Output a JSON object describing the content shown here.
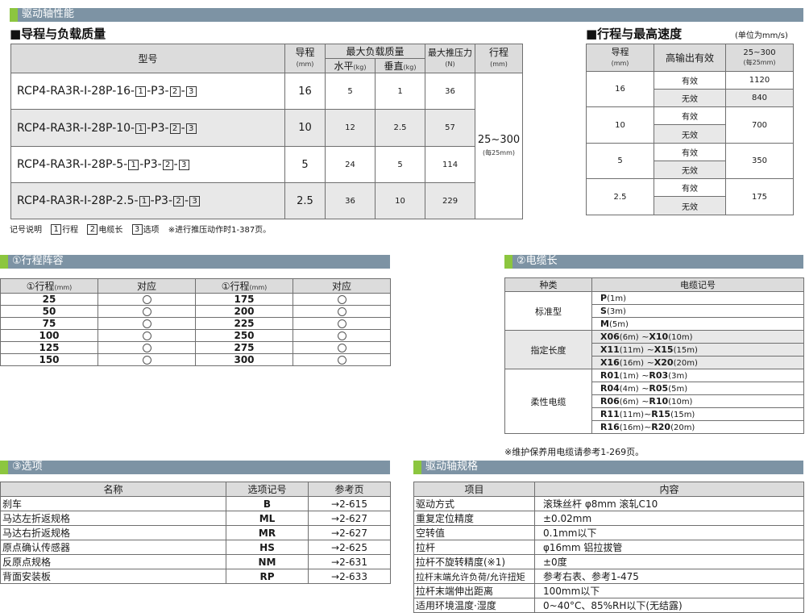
{
  "top_bar": {
    "title": "驱动轴性能"
  },
  "lead_section": {
    "title": "■导程与负载质量",
    "headers": {
      "model": "型号",
      "lead": "导程",
      "lead_unit": "(mm)",
      "max_load": "最大负载质量",
      "horizontal": "水平",
      "horizontal_unit": "(kg)",
      "vertical": "垂直",
      "vertical_unit": "(kg)",
      "max_push": "最大推压力",
      "max_push_unit": "(N)",
      "stroke": "行程",
      "stroke_unit": "(mm)"
    },
    "rows": [
      {
        "model_prefix": "RCP4-RA3R-I-28P-16-",
        "lead": "16",
        "horizontal": "5",
        "vertical": "1",
        "push": "36"
      },
      {
        "model_prefix": "RCP4-RA3R-I-28P-10-",
        "lead": "10",
        "horizontal": "12",
        "vertical": "2.5",
        "push": "57"
      },
      {
        "model_prefix": "RCP4-RA3R-I-28P-5-",
        "lead": "5",
        "horizontal": "24",
        "vertical": "5",
        "push": "114"
      },
      {
        "model_prefix": "RCP4-RA3R-I-28P-2.5-",
        "lead": "2.5",
        "horizontal": "36",
        "vertical": "10",
        "push": "229"
      }
    ],
    "model_parts": {
      "n1": "1",
      "p3": "-P3-",
      "n2": "2",
      "dash": "-",
      "n3": "3"
    },
    "stroke_value": "25~300",
    "stroke_note": "(每25mm)",
    "legend": {
      "prefix": "记号说明",
      "n1": "1",
      "l1": "行程",
      "n2": "2",
      "l2": "电缆长",
      "n3": "3",
      "l3": "选项",
      "note": "※进行推压动作时1-387页。"
    }
  },
  "speed_section": {
    "title": "■行程与最高速度",
    "unit": "(单位为mm/s)",
    "headers": {
      "lead": "导程",
      "lead_unit": "(mm)",
      "hi_out": "高输出有效",
      "stroke": "25~300",
      "stroke_note": "(每25mm)"
    },
    "rows": [
      {
        "lead": "16",
        "on": "有效",
        "off": "无效",
        "on_val": "1120",
        "off_val": "840"
      },
      {
        "lead": "10",
        "on": "有效",
        "off": "无效",
        "val": "700"
      },
      {
        "lead": "5",
        "on": "有效",
        "off": "无效",
        "val": "350"
      },
      {
        "lead": "2.5",
        "on": "有效",
        "off": "无效",
        "val": "175"
      }
    ]
  },
  "stroke_lineup": {
    "title": "①行程阵容",
    "headers": {
      "stroke": "①行程",
      "unit": "(mm)",
      "support": "对应"
    },
    "left": [
      "25",
      "50",
      "75",
      "100",
      "125",
      "150"
    ],
    "right": [
      "175",
      "200",
      "225",
      "250",
      "275",
      "300"
    ]
  },
  "cable": {
    "title": "②电缆长",
    "headers": {
      "type": "种类",
      "code": "电缆记号"
    },
    "groups": [
      {
        "type": "标准型",
        "rows": [
          {
            "a": "P",
            "al": "(1m)",
            "b": "",
            "bl": ""
          },
          {
            "a": "S",
            "al": "(3m)",
            "b": "",
            "bl": ""
          },
          {
            "a": "M",
            "al": "(5m)",
            "b": "",
            "bl": ""
          }
        ]
      },
      {
        "type": "指定长度",
        "rows": [
          {
            "a": "X06",
            "al": "(6m)",
            "b": "X10",
            "bl": "(10m)"
          },
          {
            "a": "X11",
            "al": "(11m)",
            "b": "X15",
            "bl": "(15m)"
          },
          {
            "a": "X16",
            "al": "(16m)",
            "b": "X20",
            "bl": "(20m)"
          }
        ]
      },
      {
        "type": "柔性电缆",
        "rows": [
          {
            "a": "R01",
            "al": "(1m)",
            "b": "R03",
            "bl": "(3m)"
          },
          {
            "a": "R04",
            "al": "(4m)",
            "b": "R05",
            "bl": "(5m)"
          },
          {
            "a": "R06",
            "al": "(6m)",
            "b": "R10",
            "bl": "(10m)"
          },
          {
            "a": "R11",
            "al": "(11m)",
            "b": "R15",
            "bl": "(15m)"
          },
          {
            "a": "R16",
            "al": "(16m)",
            "b": "R20",
            "bl": "(20m)"
          }
        ]
      }
    ],
    "tilde": "~",
    "note": "※维护保养用电缆请参考1-269页。"
  },
  "options": {
    "title": "③选项",
    "headers": {
      "name": "名称",
      "code": "选项记号",
      "ref": "参考页"
    },
    "rows": [
      {
        "name": "刹车",
        "code": "B",
        "ref": "→2-615"
      },
      {
        "name": "马达左折返规格",
        "code": "ML",
        "ref": "→2-627"
      },
      {
        "name": "马达右折返规格",
        "code": "MR",
        "ref": "→2-627"
      },
      {
        "name": "原点确认传感器",
        "code": "HS",
        "ref": "→2-625"
      },
      {
        "name": "反原点规格",
        "code": "NM",
        "ref": "→2-631"
      },
      {
        "name": "背面安装板",
        "code": "RP",
        "ref": "→2-633"
      }
    ]
  },
  "specs": {
    "title": "驱动轴规格",
    "headers": {
      "item": "项目",
      "content": "内容"
    },
    "rows": [
      {
        "item": "驱动方式",
        "content": "滚珠丝杆 φ8mm 滚轧C10"
      },
      {
        "item": "重复定位精度",
        "content": "±0.02mm"
      },
      {
        "item": "空转值",
        "content": "0.1mm以下"
      },
      {
        "item": "拉杆",
        "content": "φ16mm 铝拉拔管"
      },
      {
        "item": "拉杆不旋转精度(※1)",
        "content": "±0度"
      },
      {
        "item": "拉杆末端允许负荷/允许扭矩",
        "content": "参考右表、参考1-475"
      },
      {
        "item": "拉杆末端伸出距离",
        "content": "100mm以下"
      },
      {
        "item": "适用环境温度·湿度",
        "content": "0~40°C、85%RH以下(无结露)"
      }
    ]
  }
}
